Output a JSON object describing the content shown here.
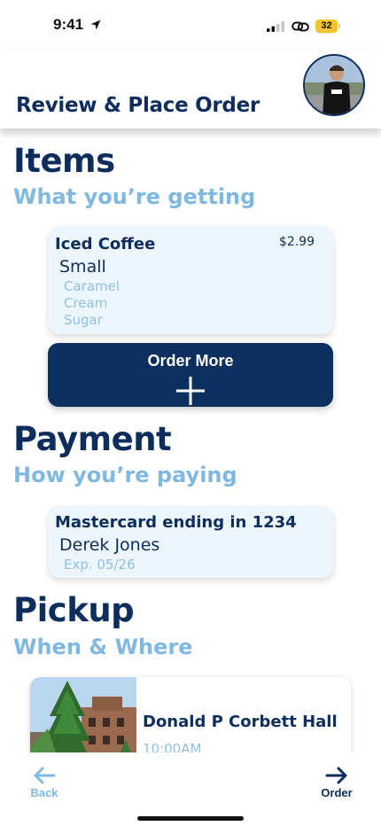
{
  "status_bar": {
    "time": "9:41",
    "battery": "32"
  },
  "header": {
    "title": "Review & Place Order",
    "avatar_icon": "user-photo"
  },
  "items_section": {
    "heading": "Items",
    "subheading": "What you’re getting",
    "items": [
      {
        "name": "Iced Coffee",
        "price": "$2.99",
        "size": "Small",
        "modifiers": [
          "Caramel",
          "Cream",
          "Sugar"
        ]
      }
    ],
    "order_more_label": "Order More"
  },
  "payment_section": {
    "heading": "Payment",
    "subheading": "How you’re paying",
    "card_title": "Mastercard ending in 1234",
    "cardholder": "Derek Jones",
    "expiry": "Exp. 05/26"
  },
  "pickup_section": {
    "heading": "Pickup",
    "subheading": "When & Where",
    "location": "Donald P Corbett Hall",
    "time": "10:00AM"
  },
  "bottom_nav": {
    "back_label": "Back",
    "order_label": "Order"
  },
  "colors": {
    "navy": "#0d2d5c",
    "button_navy": "#0b2f5f",
    "light_blue": "#7fb8e2",
    "card_bg": "#eef6fd"
  }
}
